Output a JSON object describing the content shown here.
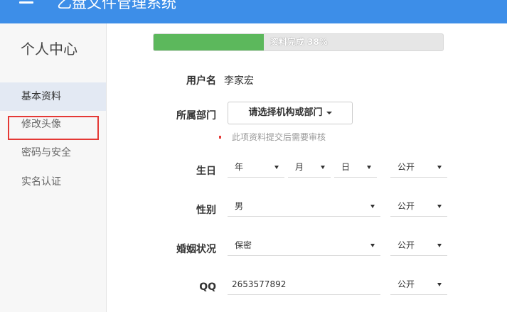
{
  "app": {
    "title": "乙盘文件管理系统"
  },
  "sidebar": {
    "title": "个人中心",
    "items": [
      {
        "label": "基本资料"
      },
      {
        "label": "修改头像"
      },
      {
        "label": "密码与安全"
      },
      {
        "label": "实名认证"
      }
    ]
  },
  "progress": {
    "label": "资料完成 38%",
    "percent": 38
  },
  "form": {
    "username": {
      "label": "用户名",
      "value": "李家宏"
    },
    "department": {
      "label": "所属部门",
      "button": "请选择机构或部门",
      "hint": "此项资料提交后需要审核"
    },
    "birthday": {
      "label": "生日",
      "year": "年",
      "month": "月",
      "day": "日",
      "privacy": "公开"
    },
    "gender": {
      "label": "性别",
      "value": "男",
      "privacy": "公开"
    },
    "marital": {
      "label": "婚姻状况",
      "value": "保密",
      "privacy": "公开"
    },
    "qq": {
      "label": "QQ",
      "value": "2653577892",
      "privacy": "公开"
    }
  },
  "colors": {
    "topbar": "#3d8ee8",
    "progress": "#5cb85c",
    "highlight": "#e53935"
  }
}
